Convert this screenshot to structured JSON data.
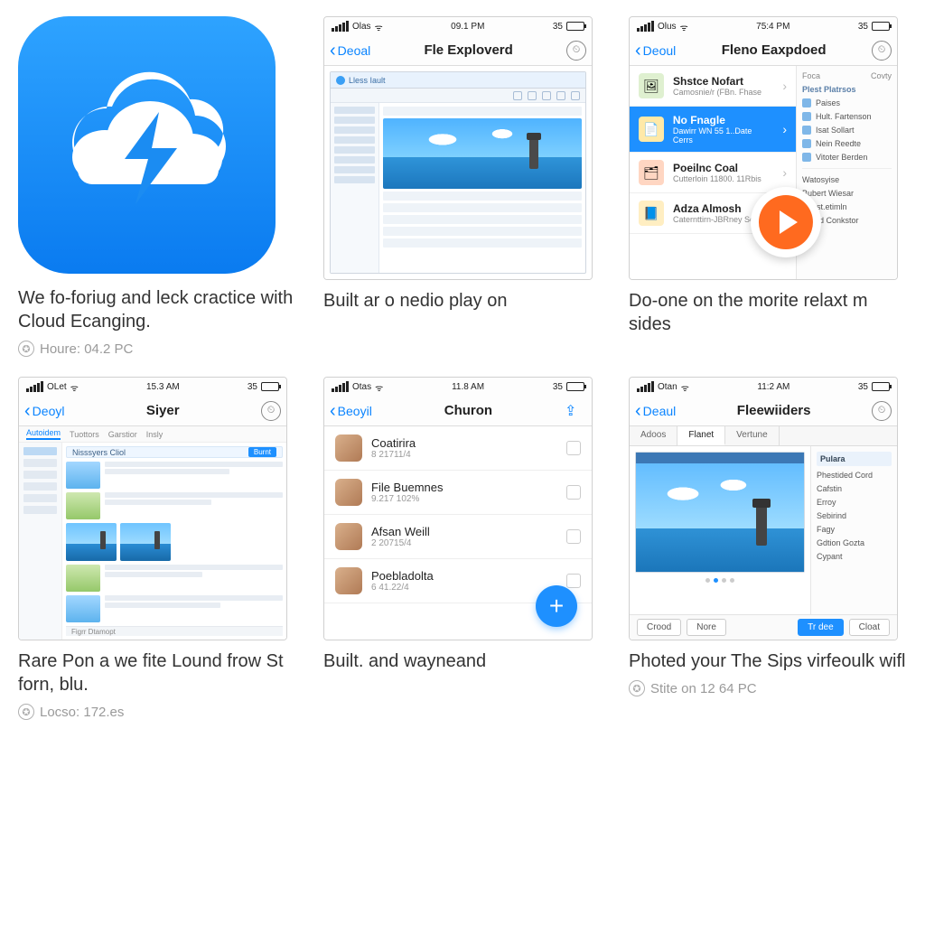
{
  "cells": [
    {
      "kind": "icon",
      "caption": "We fo-foriug and leck cractice with Cloud Ecanging.",
      "meta": "Houre: 04.2 PC"
    },
    {
      "kind": "phone",
      "statusbar": {
        "carrier": "Olas",
        "time": "09.1 PM",
        "pct": "35"
      },
      "nav": {
        "back": "Deoal",
        "title": "Fle Exploverd"
      },
      "caption": "Built ar o nedio play on",
      "mini": {
        "title": "Lless Iault"
      }
    },
    {
      "kind": "phone",
      "statusbar": {
        "carrier": "Olus",
        "time": "75:4 PM",
        "pct": "35"
      },
      "nav": {
        "back": "Deoul",
        "title": "Fleno Eaxpdoed"
      },
      "caption": "Do-one on the morite relaxt m sides",
      "list": [
        {
          "title": "Shstce Nofart",
          "sub": "Camosnie/r (FBn. Fhase"
        },
        {
          "title": "No Fnagle",
          "sub": "Dawirr WN 55 1..Date Cerrs",
          "selected": true
        },
        {
          "title": "Poeilnc Coal",
          "sub": "Cutterloin 11800. 11Rbis"
        },
        {
          "title": "Adza Almosh",
          "sub": "Caternttirn-JBRney Sen"
        }
      ],
      "panel": {
        "tabs": [
          "Foca",
          "Covty"
        ],
        "header": "Plest Platrsos",
        "items": [
          "Paises",
          "Hult. Fartenson",
          "Isat Sollart",
          "Nein Reedte",
          "Vitoter Berden"
        ],
        "footer": [
          "Watosyise",
          "Bubert Wiesar",
          "Rayst.etimln",
          "Nemd Conkstor"
        ]
      }
    },
    {
      "kind": "phone",
      "statusbar": {
        "carrier": "OLet",
        "time": "15.3 AM",
        "pct": "35"
      },
      "nav": {
        "back": "Deoyl",
        "title": "Siyer"
      },
      "caption": "Rare Pon a we fite Lound frow St forn, blu.",
      "meta": "Locso: 172.es",
      "tabs": [
        "Autoidem",
        "Tuottors",
        "Garstior",
        "Insly"
      ],
      "panelTitle": "Nisssyers Cliol",
      "panelBtn": "Burnt"
    },
    {
      "kind": "phone",
      "statusbar": {
        "carrier": "Otas",
        "time": "11.8 AM",
        "pct": "35"
      },
      "nav": {
        "back": "Beoyil",
        "title": "Churon"
      },
      "caption": "Built. and wayneand",
      "contacts": [
        {
          "name": "Coatirira",
          "date": "8 21711/4"
        },
        {
          "name": "File Buemnes",
          "date": "9.217 102%"
        },
        {
          "name": "Afsan Weill",
          "date": "2 20715/4"
        },
        {
          "name": "Poebladolta",
          "date": "6 41.22/4"
        }
      ]
    },
    {
      "kind": "phone",
      "statusbar": {
        "carrier": "Otan",
        "time": "11:2 AM",
        "pct": "35"
      },
      "nav": {
        "back": "Deaul",
        "title": "Fleewiiders"
      },
      "caption": "Photed your The Sips virfeoulk wifl",
      "meta": "Stite on 12 64 PC",
      "fwTabs": [
        "Adoos",
        "Flanet",
        "Vertune"
      ],
      "fwSideHeader": "Pulara",
      "fwSide": [
        "Phestided Cord",
        "Cafstin",
        "Erroy",
        "Sebirind",
        "Fagy",
        "Gdtion Gozta",
        "Cypant"
      ],
      "fwFoot": [
        "Crood",
        "Nore",
        "Tr dee",
        "Cloat"
      ]
    }
  ]
}
